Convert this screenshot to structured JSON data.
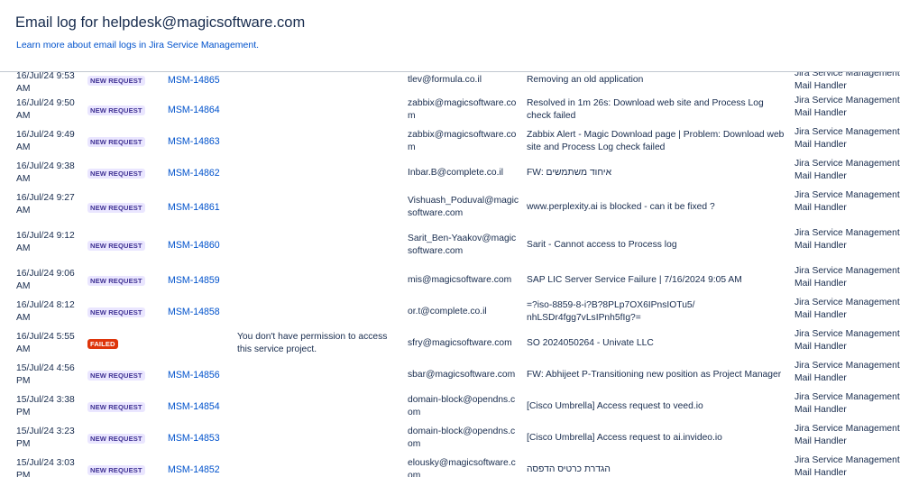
{
  "header": {
    "title": "Email log for helpdesk@magicsoftware.com",
    "learn_more": "Learn more about email logs in Jira Service Management."
  },
  "status_colors": {
    "new_request": "#eae6ff",
    "failed": "#de350b",
    "link": "#0052cc"
  },
  "rows": [
    {
      "date": "16/Jul/24 9:53 AM",
      "status": "NEW REQUEST",
      "status_type": "new",
      "issue": "MSM-14865",
      "error": "",
      "from": "tlev@formula.co.il",
      "subject": "Removing an old application",
      "handler": "Jira Service Management Mail Handler"
    },
    {
      "date": "16/Jul/24 9:50 AM",
      "status": "NEW REQUEST",
      "status_type": "new",
      "issue": "MSM-14864",
      "error": "",
      "from": "zabbix@magicsoftware.com",
      "subject": "Resolved in 1m 26s: Download web site and Process Log check failed",
      "handler": "Jira Service Management Mail Handler"
    },
    {
      "date": "16/Jul/24 9:49 AM",
      "status": "NEW REQUEST",
      "status_type": "new",
      "issue": "MSM-14863",
      "error": "",
      "from": "zabbix@magicsoftware.com",
      "subject": "Zabbix Alert - Magic Download page | Problem: Download web site and Process Log check failed",
      "handler": "Jira Service Management Mail Handler"
    },
    {
      "date": "16/Jul/24 9:38 AM",
      "status": "NEW REQUEST",
      "status_type": "new",
      "issue": "MSM-14862",
      "error": "",
      "from": "Inbar.B@complete.co.il",
      "subject": "FW: איחוד משתמשים",
      "handler": "Jira Service Management Mail Handler"
    },
    {
      "date": "16/Jul/24 9:27 AM",
      "status": "NEW REQUEST",
      "status_type": "new",
      "issue": "MSM-14861",
      "error": "",
      "from": "Vishuash_Poduval@magicsoftware.com",
      "subject": "www.perplexity.ai is blocked - can it be fixed ?",
      "handler": "Jira Service Management Mail Handler"
    },
    {
      "date": "16/Jul/24 9:12 AM",
      "status": "NEW REQUEST",
      "status_type": "new",
      "issue": "MSM-14860",
      "error": "",
      "from": "Sarit_Ben-Yaakov@magicsoftware.com",
      "subject": "Sarit - Cannot access to Process log",
      "handler": "Jira Service Management Mail Handler"
    },
    {
      "date": "16/Jul/24 9:06 AM",
      "status": "NEW REQUEST",
      "status_type": "new",
      "issue": "MSM-14859",
      "error": "",
      "from": "mis@magicsoftware.com",
      "subject": "SAP LIC Server Service Failure | 7/16/2024 9:05 AM",
      "handler": "Jira Service Management Mail Handler"
    },
    {
      "date": "16/Jul/24 8:12 AM",
      "status": "NEW REQUEST",
      "status_type": "new",
      "issue": "MSM-14858",
      "error": "",
      "from": "or.t@complete.co.il",
      "subject": "=?iso-8859-8-i?B?8PLp7OX6IPnsIOTu5/ nhLSDr4fgg7vLsIPnh5fIg?=",
      "handler": "Jira Service Management Mail Handler"
    },
    {
      "date": "16/Jul/24 5:55 AM",
      "status": "FAILED",
      "status_type": "failed",
      "issue": "",
      "error": "You don't have permission to access this service project.",
      "from": "sfry@magicsoftware.com",
      "subject": "SO 2024050264 - Univate LLC",
      "handler": "Jira Service Management Mail Handler"
    },
    {
      "date": "15/Jul/24 4:56 PM",
      "status": "NEW REQUEST",
      "status_type": "new",
      "issue": "MSM-14856",
      "error": "",
      "from": "sbar@magicsoftware.com",
      "subject": "FW: Abhijeet P-Transitioning new position as Project Manager",
      "handler": "Jira Service Management Mail Handler"
    },
    {
      "date": "15/Jul/24 3:38 PM",
      "status": "NEW REQUEST",
      "status_type": "new",
      "issue": "MSM-14854",
      "error": "",
      "from": "domain-block@opendns.com",
      "subject": "[Cisco Umbrella] Access request to veed.io",
      "handler": "Jira Service Management Mail Handler"
    },
    {
      "date": "15/Jul/24 3:23 PM",
      "status": "NEW REQUEST",
      "status_type": "new",
      "issue": "MSM-14853",
      "error": "",
      "from": "domain-block@opendns.com",
      "subject": "[Cisco Umbrella] Access request to ai.invideo.io",
      "handler": "Jira Service Management Mail Handler"
    },
    {
      "date": "15/Jul/24 3:03 PM",
      "status": "NEW REQUEST",
      "status_type": "new",
      "issue": "MSM-14852",
      "error": "",
      "from": "elousky@magicsoftware.com",
      "subject": "הגדרת כרטיס הדפסה",
      "handler": "Jira Service Management Mail Handler"
    }
  ]
}
